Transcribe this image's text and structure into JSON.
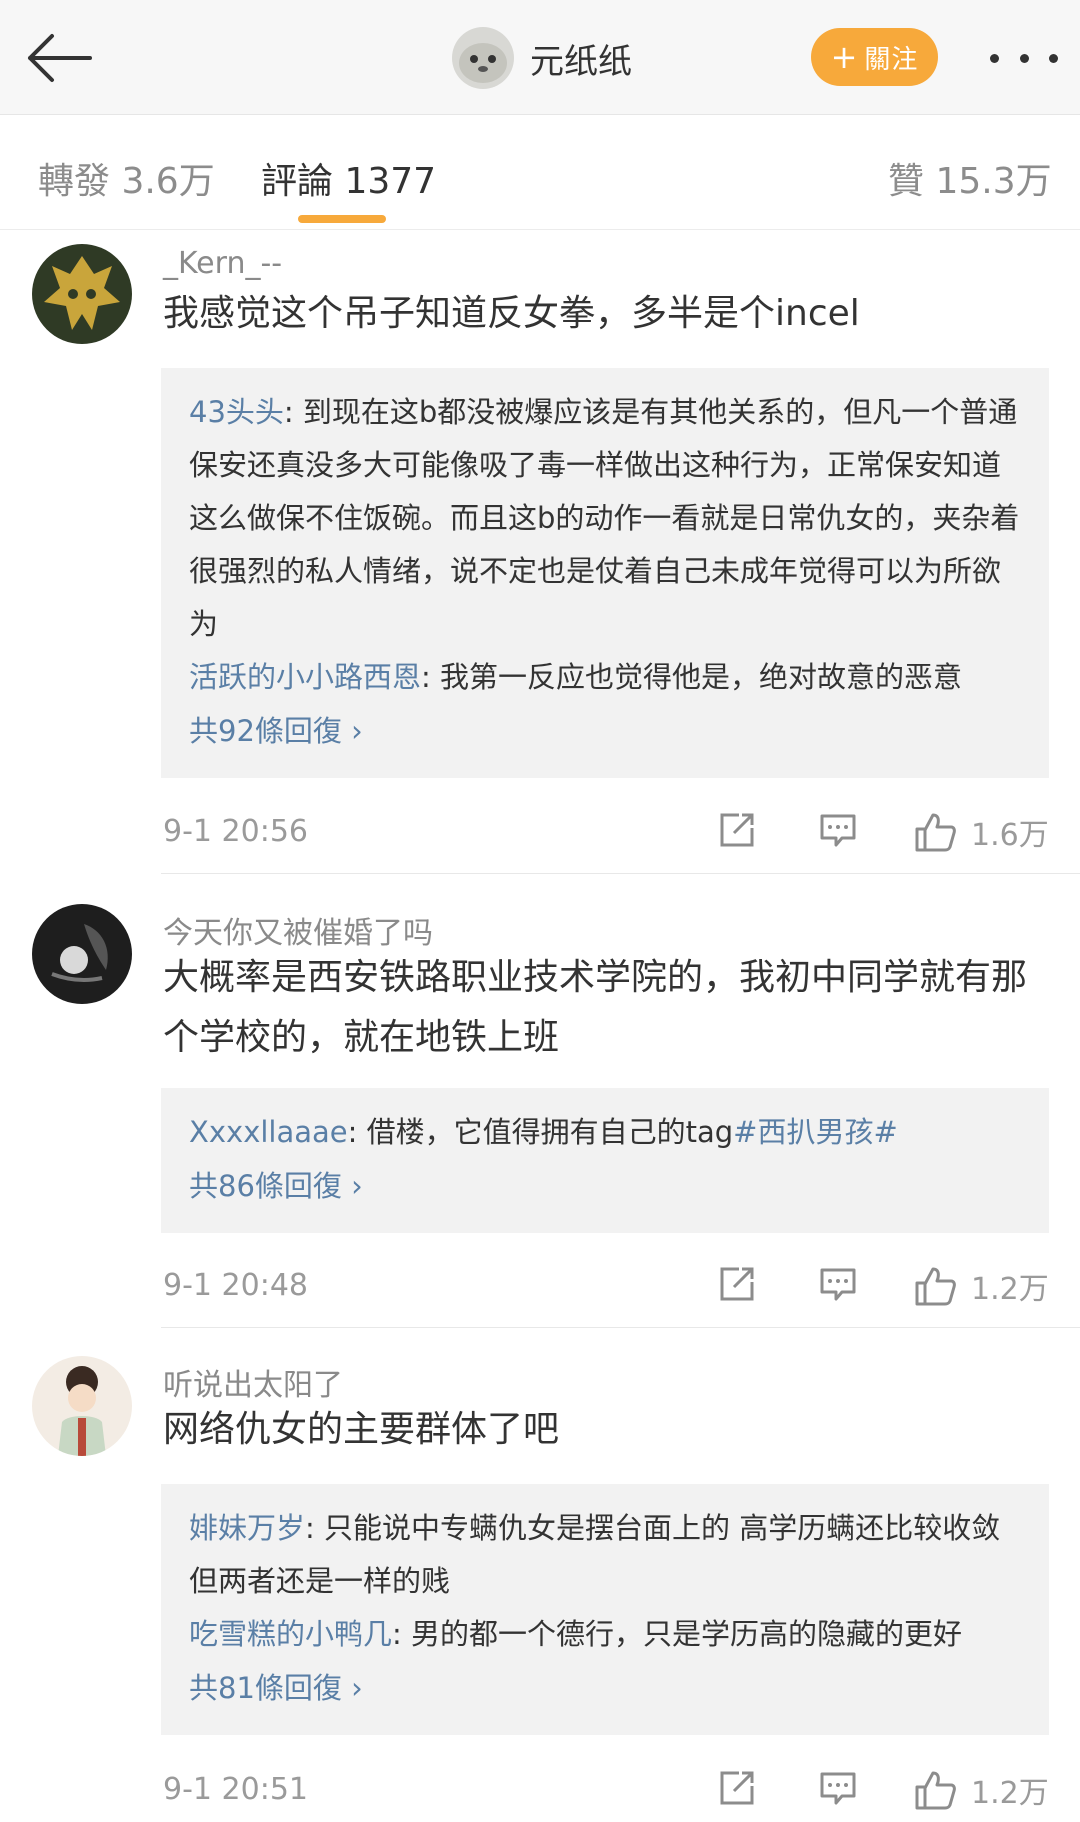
{
  "header": {
    "author_name": "元纸纸",
    "follow_label": "關注",
    "follow_icon": "plus-icon"
  },
  "tabs": [
    {
      "label": "轉發 3.6万"
    },
    {
      "label": "評論 1377",
      "active": true
    },
    {
      "label": "贊 15.3万"
    }
  ],
  "comments": [
    {
      "username": "_Kern_--",
      "text": "我感觉这个吊子知道反女拳，多半是个incel",
      "replies": [
        {
          "name": "43头头",
          "text": ": 到现在这b都没被爆应该是有其他关系的，但凡一个普通保安还真没多大可能像吸了毒一样做出这种行为，正常保安知道这么做保不住饭碗。而且这b的动作一看就是日常仇女的，夹杂着很强烈的私人情绪，说不定也是仗着自己未成年觉得可以为所欲为"
        },
        {
          "name": "活跃的小小路西恩",
          "text": ": 我第一反应也觉得他是，绝对故意的恶意"
        }
      ],
      "more_replies": "共92條回復 ›",
      "time": "9-1 20:56",
      "likes": "1.6万"
    },
    {
      "username": "今天你又被催婚了吗",
      "text": "大概率是西安铁路职业技术学院的，我初中同学就有那个学校的，就在地铁上班",
      "replies": [
        {
          "name": "Xxxxllaaae",
          "text": ": 借楼，它值得拥有自己的tag",
          "tag": "#西扒男孩#"
        }
      ],
      "more_replies": "共86條回復 ›",
      "time": "9-1 20:48",
      "likes": "1.2万"
    },
    {
      "username": "听说出太阳了",
      "text": "网络仇女的主要群体了吧",
      "replies": [
        {
          "name": "婔妹万岁",
          "text": ": 只能说中专螨仇女是摆台面上的 高学历螨还比较收敛 但两者还是一样的贱"
        },
        {
          "name": "吃雪糕的小鸭几",
          "text": ": 男的都一个德行，只是学历高的隐藏的更好"
        }
      ],
      "more_replies": "共81條回復 ›",
      "time": "9-1 20:51",
      "likes": "1.2万"
    }
  ],
  "icons": {
    "back": "arrow-left-icon",
    "more": "more-dots-icon",
    "share": "share-icon",
    "comment": "comment-icon",
    "like": "thumbs-up-icon"
  },
  "colors": {
    "accent": "#f7a93b",
    "link": "#5a7fa6",
    "reply_bg": "#f2f2f2"
  }
}
